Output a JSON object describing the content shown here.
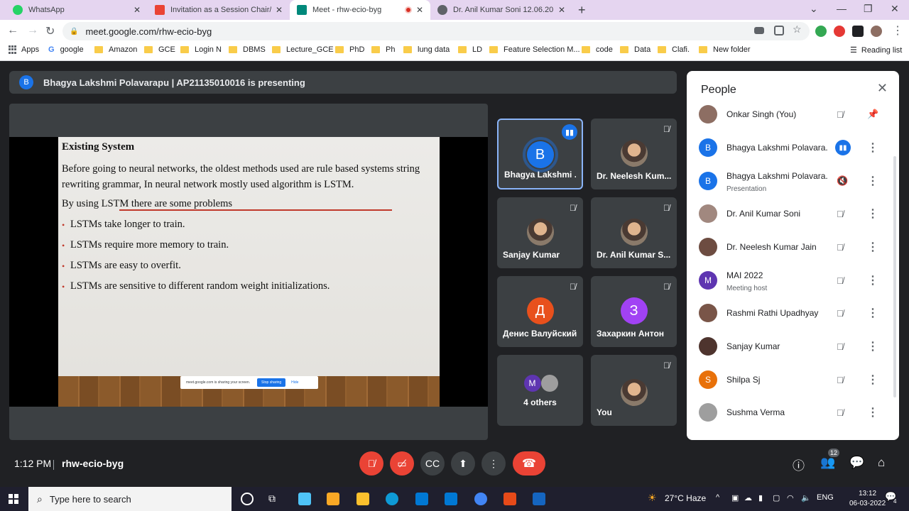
{
  "browser": {
    "tabs": [
      {
        "title": "WhatsApp",
        "color": "#25d366"
      },
      {
        "title": "Invitation as a Session Chair/ Co",
        "color": "#ea4335"
      },
      {
        "title": "Meet - rhw-ecio-byg",
        "color": "#00897b"
      },
      {
        "title": "Dr. Anil Kumar Soni 12.06.20.pdf",
        "color": "#5f6368"
      }
    ],
    "url": "meet.google.com/rhw-ecio-byg",
    "bookmarks": [
      "Apps",
      "google",
      "Amazon",
      "GCE",
      "Login N",
      "DBMS",
      "Lecture_GCE",
      "PhD",
      "Ph",
      "lung data",
      "LD",
      "Feature Selection M...",
      "code",
      "Data",
      "Clafi.",
      "New folder"
    ],
    "reading_list": "Reading list"
  },
  "meet": {
    "presenter_initial": "B",
    "presenting_text": "Bhagya Lakshmi Polavarapu | AP21135010016 is presenting",
    "slide": {
      "title": "Existing System",
      "para1": "Before going to neural networks, the oldest methods used are  rule based systems string rewriting grammar, In neural network mostly used algorithm is LSTM.",
      "para2": "By using LSTM there are some problems",
      "bullets": [
        "LSTMs take longer to train.",
        "LSTMs require more memory to train.",
        "LSTMs are easy to overfit.",
        "LSTMs are sensitive to different random weight initializations."
      ],
      "share_text": "meet.google.com is sharing your screen.",
      "stop_sharing": "Stop sharing",
      "hide": "Hide"
    },
    "tiles": [
      {
        "name": "Bhagya Lakshmi ...",
        "initial": "B",
        "color": "#1a73e8"
      },
      {
        "name": "Dr. Neelesh Kum...",
        "initial": ""
      },
      {
        "name": "Sanjay Kumar",
        "initial": ""
      },
      {
        "name": "Dr. Anil Kumar S...",
        "initial": ""
      },
      {
        "name": "Денис Валуйский",
        "initial": "Д",
        "color": "#e8501c"
      },
      {
        "name": "Захаркин Антон",
        "initial": "З",
        "color": "#a142f4"
      },
      {
        "name": "4 others",
        "initial": "M",
        "color": "#5e35b1"
      },
      {
        "name": "You",
        "initial": ""
      }
    ],
    "people": {
      "title": "People",
      "rows": [
        {
          "name": "Onkar Singh (You)",
          "sub": "",
          "initial": "",
          "color": "#8d6e63"
        },
        {
          "name": "Bhagya Lakshmi Polavara...",
          "sub": "",
          "initial": "B",
          "color": "#1a73e8"
        },
        {
          "name": "Bhagya Lakshmi Polavara...",
          "sub": "Presentation",
          "initial": "B",
          "color": "#1a73e8"
        },
        {
          "name": "Dr. Anil Kumar Soni",
          "sub": "",
          "initial": "",
          "color": "#a1887f"
        },
        {
          "name": "Dr. Neelesh Kumar Jain",
          "sub": "",
          "initial": "",
          "color": "#6d4c41"
        },
        {
          "name": "MAI 2022",
          "sub": "Meeting host",
          "initial": "M",
          "color": "#5e35b1"
        },
        {
          "name": "Rashmi Rathi Upadhyay",
          "sub": "",
          "initial": "",
          "color": "#795548"
        },
        {
          "name": "Sanjay Kumar",
          "sub": "",
          "initial": "",
          "color": "#4e342e"
        },
        {
          "name": "Shilpa Sj",
          "sub": "",
          "initial": "S",
          "color": "#e8710a"
        },
        {
          "name": "Sushma Verma",
          "sub": "",
          "initial": "",
          "color": "#9e9e9e"
        }
      ]
    },
    "time": "1:12 PM",
    "code": "rhw-ecio-byg",
    "participant_count": "12"
  },
  "taskbar": {
    "search_placeholder": "Type here to search",
    "weather": "27°C Haze",
    "lang": "ENG",
    "time": "13:12",
    "date": "06-03-2022",
    "notif_count": "4"
  }
}
